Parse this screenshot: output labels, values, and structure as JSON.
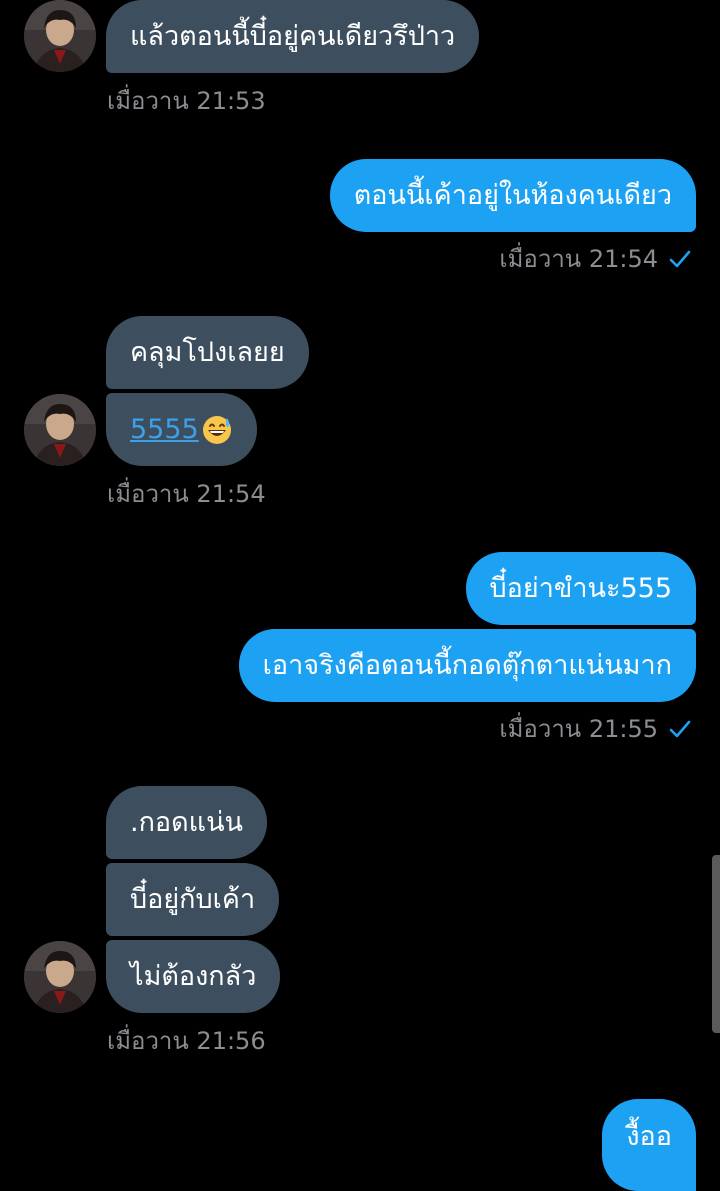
{
  "conversation": {
    "messages": [
      {
        "id": "m1",
        "text": "แล้วตอนนี้บี๋อยู่คนเดียวรึป่าว"
      },
      {
        "id": "m2",
        "text": "ตอนนี้เค้าอยู่ในห้องคนเดียว"
      },
      {
        "id": "m3",
        "text": "คลุมโปงเลยย"
      },
      {
        "id": "m4",
        "link": "5555",
        "emoji": "grinning-sweat-emoji"
      },
      {
        "id": "m5",
        "text": "บี๋อย่าขำนะ555"
      },
      {
        "id": "m6",
        "text": "เอาจริงคือตอนนี้กอดตุ๊กตาแน่นมาก"
      },
      {
        "id": "m7",
        "text": ".กอดแน่น"
      },
      {
        "id": "m8",
        "text": "บี๋อยู่กับเค้า"
      },
      {
        "id": "m9",
        "text": "ไม่ต้องกลัว"
      },
      {
        "id": "m10",
        "text": "งื้ออ"
      }
    ],
    "timestamps": {
      "t1": "เมื่อวาน 21:53",
      "t2": "เมื่อวาน 21:54",
      "t3": "เมื่อวาน 21:54",
      "t4": "เมื่อวาน 21:55",
      "t5": "เมื่อวาน 21:56"
    },
    "read_receipt_icon": "check-icon"
  },
  "colors": {
    "background": "#000000",
    "incoming_bubble": "#3d4f5e",
    "outgoing_bubble": "#1da1f2",
    "timestamp": "#8a8d91",
    "check": "#1da1f2",
    "link": "#3ea0e8"
  }
}
